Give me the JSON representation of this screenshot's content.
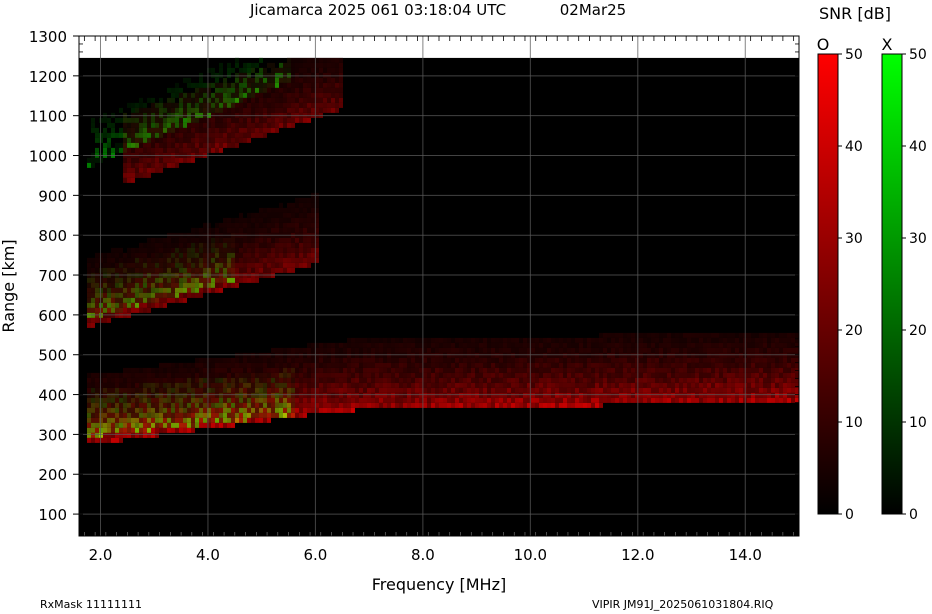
{
  "chart_data": {
    "type": "heatmap",
    "title": "Jicamarca 2025 061 03:18:04 UTC",
    "date": "02Mar25",
    "xlabel": "Frequency [MHz]",
    "ylabel": "Range [km]",
    "xlim": [
      1.6,
      15.0
    ],
    "ylim": [
      45,
      1300
    ],
    "data_top_range_km": 1245,
    "xticks": [
      2.0,
      4.0,
      6.0,
      8.0,
      10.0,
      12.0,
      14.0
    ],
    "xtick_labels": [
      "2.0",
      "4.0",
      "6.0",
      "8.0",
      "10.0",
      "12.0",
      "14.0"
    ],
    "yticks": [
      100,
      200,
      300,
      400,
      500,
      600,
      700,
      800,
      900,
      1000,
      1100,
      1200,
      1300
    ],
    "ytick_labels": [
      "100",
      "200",
      "300",
      "400",
      "500",
      "600",
      "700",
      "800",
      "900",
      "1000",
      "1100",
      "1200",
      "1300"
    ],
    "grid": true,
    "colorbar_title": "SNR [dB]",
    "colorbars": [
      {
        "name": "O",
        "color": "#ff0000",
        "range": [
          0,
          50
        ],
        "ticks": [
          0,
          10,
          20,
          30,
          40,
          50
        ],
        "tick_labels": [
          "0",
          "10",
          "20",
          "30",
          "40",
          "50"
        ]
      },
      {
        "name": "X",
        "color": "#00ff00",
        "range": [
          0,
          50
        ],
        "ticks": [
          0,
          10,
          20,
          30,
          40,
          50
        ],
        "tick_labels": [
          "0",
          "10",
          "20",
          "30",
          "40",
          "50"
        ]
      }
    ],
    "traces": [
      {
        "name": "O-mode 1st hop",
        "mode": "O",
        "start": [
          1.7,
          285
        ],
        "end": [
          6.5,
          372
        ],
        "flat_to": [
          15.0,
          395
        ],
        "snr_db": 38
      },
      {
        "name": "X-mode 1st hop",
        "mode": "X",
        "start": [
          1.7,
          305
        ],
        "end": [
          5.6,
          360
        ],
        "snr_db": 35
      },
      {
        "name": "O-mode 2nd hop",
        "mode": "O",
        "start": [
          1.7,
          580
        ],
        "end": [
          6.0,
          740
        ],
        "snr_db": 28
      },
      {
        "name": "X-mode 2nd hop",
        "mode": "X",
        "start": [
          1.7,
          600
        ],
        "end": [
          4.5,
          700
        ],
        "snr_db": 30
      },
      {
        "name": "O-mode 3rd hop",
        "mode": "O",
        "start": [
          2.4,
          940
        ],
        "end": [
          6.5,
          1130
        ],
        "snr_db": 26
      },
      {
        "name": "X-mode 3rd hop",
        "mode": "X",
        "start": [
          1.7,
          980
        ],
        "end": [
          5.5,
          1200
        ],
        "snr_db": 28
      }
    ]
  },
  "footer": {
    "left": "RxMask 11111111",
    "right": "VIPIR  JM91J_2025061031804.RIQ"
  }
}
